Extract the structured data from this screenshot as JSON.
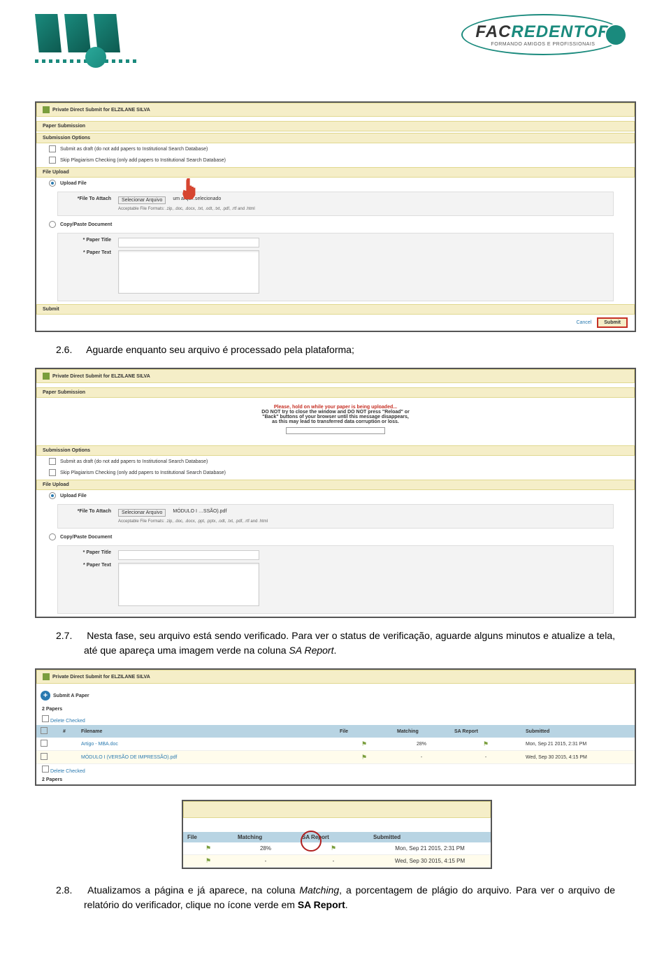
{
  "logos": {
    "ead_dots": 15,
    "facredentor_title_fac": "FAC",
    "facredentor_title_redentor": "REDENTOR",
    "facredentor_subtitle": "FORMANDO AMIGOS E PROFISSIONAIS"
  },
  "screenshot1": {
    "title": "Private Direct Submit for ELZILANE SILVA",
    "section_paper": "Paper Submission",
    "section_options": "Submission Options",
    "opt1": "Submit as draft (do not add papers to Institutional Search Database)",
    "opt2": "Skip Plagiarism Checking (only add papers to Institutional Search Database)",
    "section_file": "File Upload",
    "upload_file": "Upload File",
    "file_to_attach": "*File To Attach",
    "file_btn": "Selecionar Arquivo",
    "file_none": "um arqu...selecionado",
    "file_formats": "Acceptable File Formats: .zip, .doc, .docx, .txt, .odt, .txt, .pdf, .rtf and .html",
    "copypaste": "Copy/Paste Document",
    "paper_title": "* Paper Title",
    "paper_text": "* Paper Text",
    "section_submit": "Submit",
    "cancel": "Cancel",
    "submit": "Submit"
  },
  "text26": {
    "num": "2.6.",
    "body": "Aguarde enquanto seu arquivo é processado pela plataforma;"
  },
  "screenshot2": {
    "title": "Private Direct Submit for ELZILANE SILVA",
    "section_paper": "Paper Submission",
    "upload_red": "Please, hold on while your paper is being uploaded...",
    "upload_msg1": "DO NOT try to close the window and DO NOT press \"Reload\" or",
    "upload_msg2": "\"Back\" buttons of your browser until this message disappears,",
    "upload_msg3": "as this may lead to transferred data corruption or loss.",
    "section_options": "Submission Options",
    "opt1": "Submit as draft (do not add papers to Institutional Search Database)",
    "opt2": "Skip Plagiarism Checking (only add papers to Institutional Search Database)",
    "section_file": "File Upload",
    "upload_file": "Upload File",
    "file_to_attach": "*File To Attach",
    "file_btn": "Selecionar Arquivo",
    "file_name": "MÓDULO I …SSÃO).pdf",
    "file_formats": "Acceptable File Formats: .zip, .doc, .docx, .ppt, .pptx, .odt, .txt, .pdf, .rtf and .html",
    "copypaste": "Copy/Paste Document",
    "paper_title": "* Paper Title",
    "paper_text": "* Paper Text"
  },
  "text27": {
    "num": "2.7.",
    "body": "Nesta fase, seu arquivo está sendo verificado. Para ver o status de verificação, aguarde alguns minutos e atualize a tela, até que apareça uma imagem verde na coluna ",
    "italic": "SA Report",
    "after": "."
  },
  "screenshot3": {
    "title": "Private Direct Submit for ELZILANE SILVA",
    "submit_paper": "Submit A Paper",
    "papers_count": "2 Papers",
    "delete_checked": "Delete Checked",
    "cols": {
      "num": "#",
      "filename": "Filename",
      "file": "File",
      "matching": "Matching",
      "sareport": "SA Report",
      "submitted": "Submitted"
    },
    "rows": [
      {
        "filename": "Artigo - MBA.doc",
        "matching": "28%",
        "sareport": "✓",
        "submitted": "Mon, Sep 21 2015, 2:31 PM"
      },
      {
        "filename": "MÓDULO I (VERSÃO DE IMPRESSÃO).pdf",
        "matching": "-",
        "sareport": "-",
        "submitted": "Wed, Sep 30 2015, 4:15 PM"
      }
    ],
    "papers_count2": "2 Papers"
  },
  "screenshot4": {
    "cols": {
      "file": "File",
      "matching": "Matching",
      "sareport": "SA Report",
      "submitted": "Submitted"
    },
    "rows": [
      {
        "matching": "28%",
        "submitted": "Mon, Sep 21 2015, 2:31 PM"
      },
      {
        "matching": "-",
        "submitted": "Wed, Sep 30 2015, 4:15 PM"
      }
    ]
  },
  "text28": {
    "num": "2.8.",
    "body1": "Atualizamos a página e já aparece, na coluna ",
    "italic1": "Matching",
    "body2": ", a porcentagem de plágio do arquivo. Para ver o arquivo de relatório do verificador, clique no ícone verde em ",
    "bold": "SA Report",
    "body3": "."
  }
}
